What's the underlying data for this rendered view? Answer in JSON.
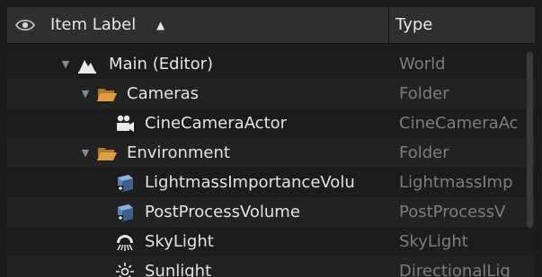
{
  "header": {
    "visibility_icon": "eye-icon",
    "label_column": "Item Label",
    "sort_indicator": "▲",
    "type_column": "Type"
  },
  "rows": [
    {
      "label": "Main (Editor)",
      "type": "World",
      "icon": "level-icon",
      "expanded": true
    },
    {
      "label": "Cameras",
      "type": "Folder",
      "icon": "folder-open-icon",
      "expanded": true
    },
    {
      "label": "CineCameraActor",
      "type": "CineCameraAc",
      "icon": "camera-icon"
    },
    {
      "label": "Environment",
      "type": "Folder",
      "icon": "folder-open-icon",
      "expanded": true
    },
    {
      "label": "LightmassImportanceVolu",
      "type": "LightmassImp",
      "icon": "volume-icon"
    },
    {
      "label": "PostProcessVolume",
      "type": "PostProcessV",
      "icon": "volume-icon"
    },
    {
      "label": "SkyLight",
      "type": "SkyLight",
      "icon": "skylight-icon"
    },
    {
      "label": "Sunlight",
      "type": "DirectionalLig",
      "icon": "sun-icon"
    }
  ],
  "colors": {
    "background": "#1c1c1c",
    "header": "#2f2f2f",
    "folder": "#e0a040",
    "text": "#e3e3e3",
    "type_text": "#7d7d7d"
  }
}
